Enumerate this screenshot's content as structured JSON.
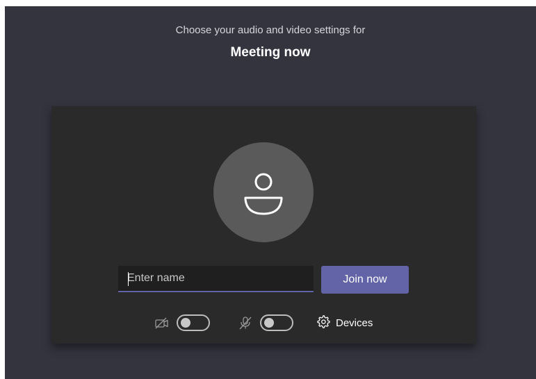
{
  "header": {
    "subtitle": "Choose your audio and video settings for",
    "meeting_title": "Meeting now"
  },
  "preview": {
    "avatar_icon": "person-icon"
  },
  "name_input": {
    "placeholder": "Enter name",
    "value": ""
  },
  "join_button": {
    "label": "Join now",
    "color": "#6264a7"
  },
  "controls": {
    "camera": {
      "icon": "camera-off-icon",
      "toggle_on": false
    },
    "microphone": {
      "icon": "mic-off-icon",
      "toggle_on": false
    },
    "devices": {
      "icon": "gear-icon",
      "label": "Devices"
    }
  },
  "colors": {
    "background": "#34343f",
    "panel": "#2a2a2a",
    "accent": "#6264a7"
  }
}
